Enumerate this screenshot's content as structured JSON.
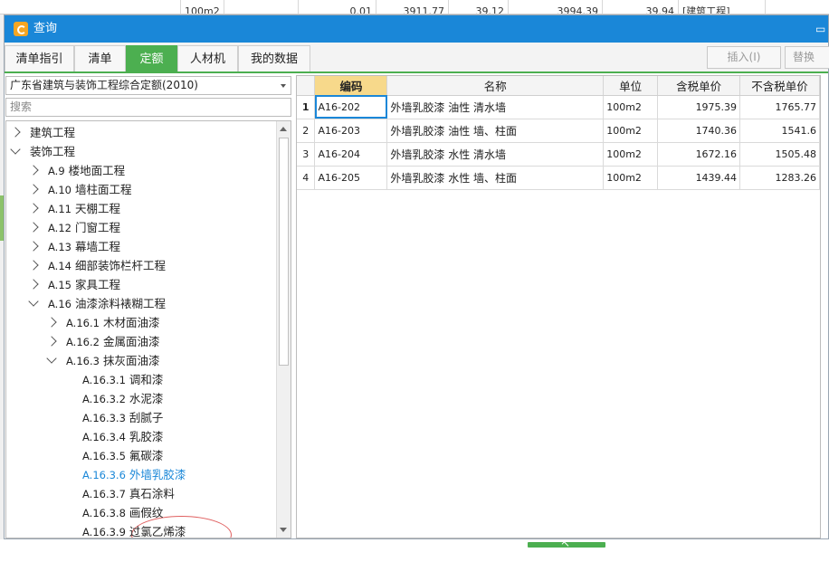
{
  "background_sheet": {
    "cells": [
      "100m2",
      "0.01",
      "3911.77",
      "39.12",
      "3994.39",
      "39.94",
      "[建筑工程]"
    ]
  },
  "window": {
    "title": "查询"
  },
  "tabs": [
    {
      "label": "清单指引",
      "active": false
    },
    {
      "label": "清单",
      "active": false
    },
    {
      "label": "定额",
      "active": true
    },
    {
      "label": "人材机",
      "active": false
    },
    {
      "label": "我的数据",
      "active": false
    }
  ],
  "toolbar": {
    "insert_label": "插入(I)",
    "replace_label": "替换"
  },
  "left_panel": {
    "quota_select": "广东省建筑与装饰工程综合定额(2010)",
    "search_placeholder": "搜索",
    "tree": [
      {
        "level": 0,
        "arrow": "right",
        "code": "",
        "label": "建筑工程"
      },
      {
        "level": 0,
        "arrow": "down",
        "code": "",
        "label": "装饰工程"
      },
      {
        "level": 1,
        "arrow": "right",
        "code": "A.9",
        "label": "楼地面工程"
      },
      {
        "level": 1,
        "arrow": "right",
        "code": "A.10",
        "label": "墙柱面工程"
      },
      {
        "level": 1,
        "arrow": "right",
        "code": "A.11",
        "label": "天棚工程"
      },
      {
        "level": 1,
        "arrow": "right",
        "code": "A.12",
        "label": "门窗工程"
      },
      {
        "level": 1,
        "arrow": "right",
        "code": "A.13",
        "label": "幕墙工程"
      },
      {
        "level": 1,
        "arrow": "right",
        "code": "A.14",
        "label": "细部装饰栏杆工程"
      },
      {
        "level": 1,
        "arrow": "right",
        "code": "A.15",
        "label": "家具工程"
      },
      {
        "level": 1,
        "arrow": "down",
        "code": "A.16",
        "label": "油漆涂料裱糊工程"
      },
      {
        "level": 2,
        "arrow": "right",
        "code": "A.16.1",
        "label": "木材面油漆"
      },
      {
        "level": 2,
        "arrow": "right",
        "code": "A.16.2",
        "label": "金属面油漆"
      },
      {
        "level": 2,
        "arrow": "down",
        "code": "A.16.3",
        "label": "抹灰面油漆"
      },
      {
        "level": 3,
        "arrow": "",
        "code": "A.16.3.1",
        "label": "调和漆"
      },
      {
        "level": 3,
        "arrow": "",
        "code": "A.16.3.2",
        "label": "水泥漆"
      },
      {
        "level": 3,
        "arrow": "",
        "code": "A.16.3.3",
        "label": "刮腻子"
      },
      {
        "level": 3,
        "arrow": "",
        "code": "A.16.3.4",
        "label": "乳胶漆"
      },
      {
        "level": 3,
        "arrow": "",
        "code": "A.16.3.5",
        "label": "氟碳漆"
      },
      {
        "level": 3,
        "arrow": "",
        "code": "A.16.3.6",
        "label": "外墙乳胶漆",
        "selected": true
      },
      {
        "level": 3,
        "arrow": "",
        "code": "A.16.3.7",
        "label": "真石涂料"
      },
      {
        "level": 3,
        "arrow": "",
        "code": "A.16.3.8",
        "label": "画假纹"
      },
      {
        "level": 3,
        "arrow": "",
        "code": "A.16.3.9",
        "label": "过氯乙烯漆"
      }
    ]
  },
  "grid": {
    "columns": [
      "编码",
      "名称",
      "单位",
      "含税单价",
      "不含税单价"
    ],
    "rows": [
      {
        "idx": "1",
        "code": "A16-202",
        "name": "外墙乳胶漆 油性 清水墙",
        "unit": "100m2",
        "tax_price": "1975.39",
        "notax_price": "1765.77"
      },
      {
        "idx": "2",
        "code": "A16-203",
        "name": "外墙乳胶漆 油性 墙、柱面",
        "unit": "100m2",
        "tax_price": "1740.36",
        "notax_price": "1541.6"
      },
      {
        "idx": "3",
        "code": "A16-204",
        "name": "外墙乳胶漆 水性 清水墙",
        "unit": "100m2",
        "tax_price": "1672.16",
        "notax_price": "1505.48"
      },
      {
        "idx": "4",
        "code": "A16-205",
        "name": "外墙乳胶漆 水性 墙、柱面",
        "unit": "100m2",
        "tax_price": "1439.44",
        "notax_price": "1283.26"
      }
    ]
  },
  "colors": {
    "titlebar": "#1a87d8",
    "active_tab": "#4caf50",
    "selected_tree": "#1a87d8",
    "header_highlight": "#f7d98b",
    "annotation": "#e06060"
  }
}
